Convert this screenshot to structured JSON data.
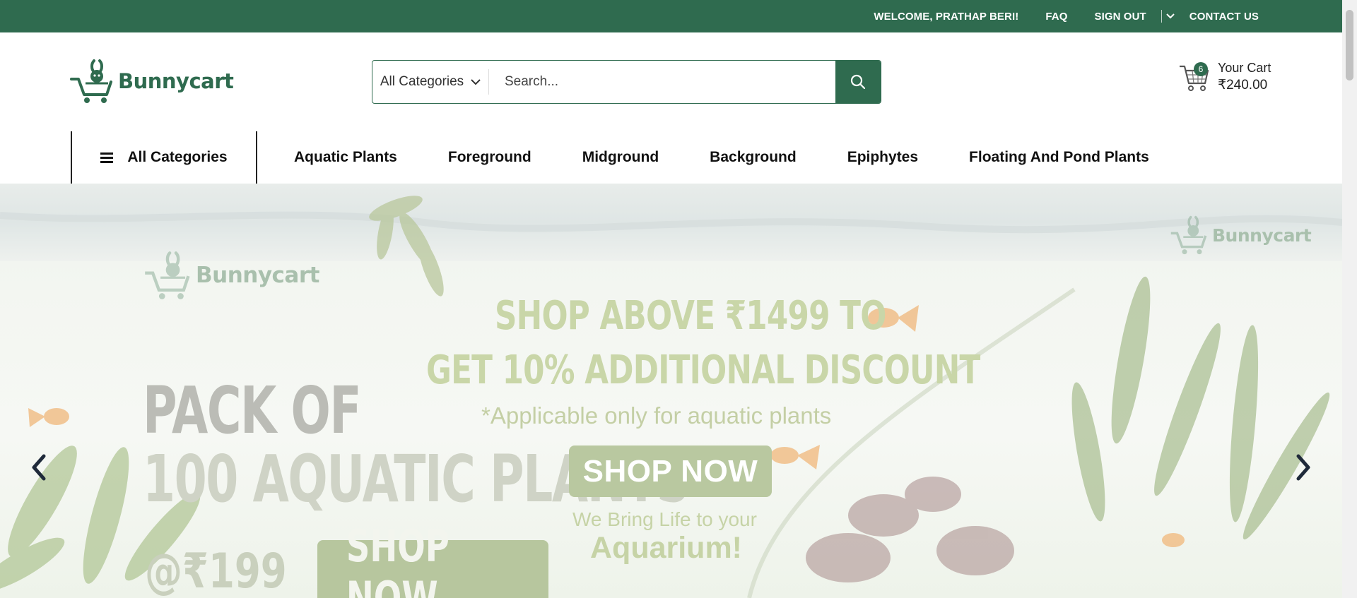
{
  "topbar": {
    "welcome": "WELCOME, PRATHAP BERI!",
    "faq": "FAQ",
    "signout": "SIGN OUT",
    "contact": "CONTACT US"
  },
  "header": {
    "brand": "Bunnycart",
    "search": {
      "category": "All Categories",
      "placeholder": "Search..."
    },
    "cart": {
      "count": "6",
      "label": "Your Cart",
      "total": "₹240.00"
    }
  },
  "nav": {
    "all_categories": "All Categories",
    "items": [
      "Aquatic Plants",
      "Foreground",
      "Midground",
      "Background",
      "Epiphytes",
      "Floating And Pond Plants"
    ]
  },
  "hero": {
    "headline1": "SHOP ABOVE ₹1499 TO",
    "headline2": "GET 10% ADDITIONAL DISCOUNT",
    "note": "*Applicable only for aquatic plants",
    "cta1": "SHOP NOW",
    "tagline1": "We Bring Life to your",
    "tagline2": "Aquarium!",
    "pack1": "PACK OF",
    "pack2": "100 AQUATIC PLANTS",
    "price": "@₹199",
    "cta2": "SHOP NOW",
    "brand_left": "Bunnycart",
    "brand_right": "Bunnycart"
  },
  "colors": {
    "brand_green": "#2f6b4f"
  }
}
